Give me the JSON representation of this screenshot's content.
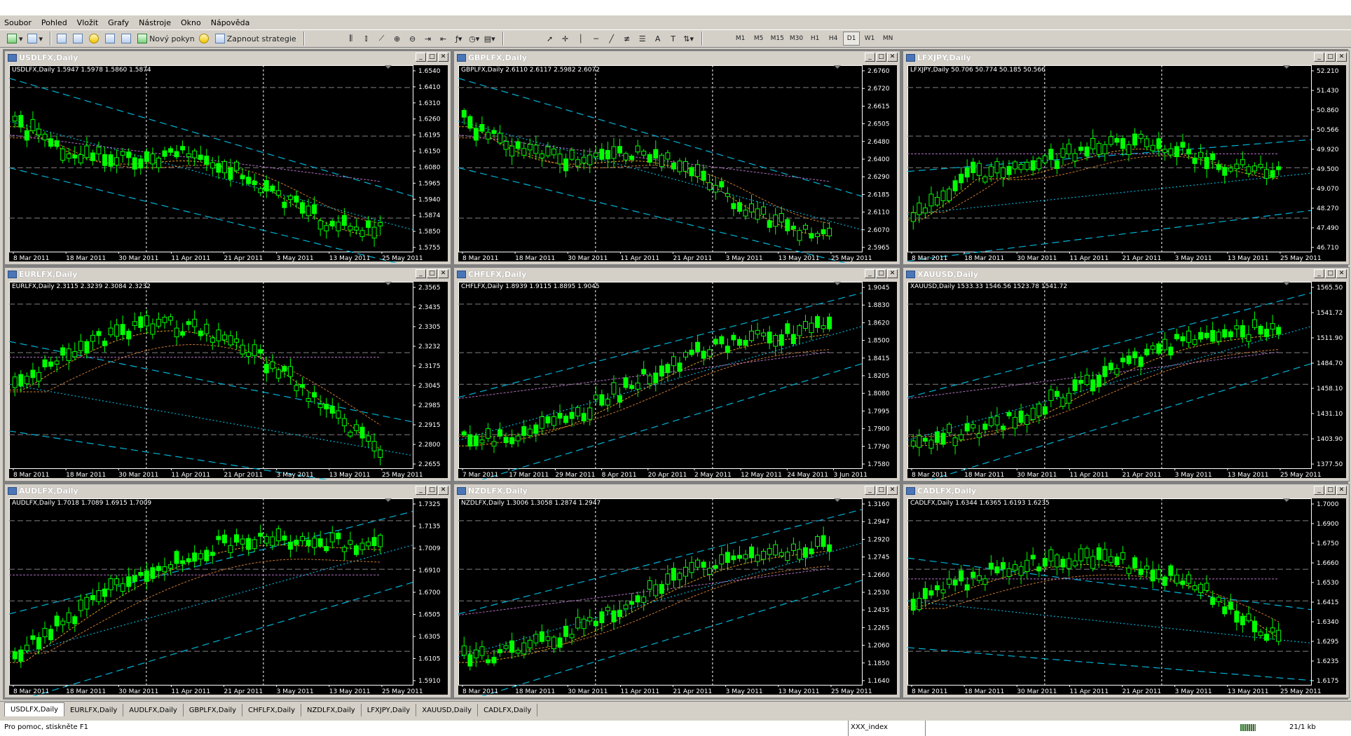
{
  "menu": [
    "Soubor",
    "Pohled",
    "Vložit",
    "Grafy",
    "Nástroje",
    "Okno",
    "Nápověda"
  ],
  "toolbar": {
    "new_order": "Nový pokyn",
    "strategies": "Zapnout strategie",
    "timeframes": [
      "M1",
      "M5",
      "M15",
      "M30",
      "H1",
      "H4",
      "D1",
      "W1",
      "MN"
    ],
    "active_tf": "D1"
  },
  "charts": [
    {
      "title": "USDLFX,Daily",
      "ohlc": "USDLFX,Daily  1.5947 1.5978 1.5860 1.5874",
      "prices": [
        "1.6540",
        "1.6410",
        "1.6310",
        "1.6260",
        "1.6195",
        "1.6150",
        "1.6080",
        "1.5965",
        "1.5940",
        "1.5874",
        "1.5850",
        "1.5755"
      ],
      "dates": [
        "8 Mar 2011",
        "18 Mar 2011",
        "30 Mar 2011",
        "11 Apr 2011",
        "21 Apr 2011",
        "3 May 2011",
        "13 May 2011",
        "25 May 2011"
      ],
      "trend": "down"
    },
    {
      "title": "GBPLFX,Daily",
      "ohlc": "GBPLFX,Daily  2.6110 2.6117 2.5982 2.6072",
      "prices": [
        "2.6760",
        "2.6720",
        "2.6615",
        "2.6505",
        "2.6480",
        "2.6400",
        "2.6290",
        "2.6185",
        "2.6110",
        "2.6070",
        "2.5965"
      ],
      "dates": [
        "8 Mar 2011",
        "18 Mar 2011",
        "30 Mar 2011",
        "11 Apr 2011",
        "21 Apr 2011",
        "3 May 2011",
        "13 May 2011",
        "25 May 2011"
      ],
      "trend": "down"
    },
    {
      "title": "LFXJPY,Daily",
      "ohlc": "LFXJPY,Daily  50.706 50.774 50.185 50.566",
      "prices": [
        "52.210",
        "51.430",
        "50.860",
        "50.566",
        "49.920",
        "49.500",
        "49.070",
        "48.270",
        "47.490",
        "46.710"
      ],
      "dates": [
        "8 Mar 2011",
        "18 Mar 2011",
        "30 Mar 2011",
        "11 Apr 2011",
        "21 Apr 2011",
        "3 May 2011",
        "13 May 2011",
        "25 May 2011"
      ],
      "trend": "flat"
    },
    {
      "title": "EURLFX,Daily",
      "ohlc": "EURLFX,Daily  2.3115 2.3239 2.3084 2.3232",
      "prices": [
        "2.3565",
        "2.3435",
        "2.3305",
        "2.3232",
        "2.3175",
        "2.3045",
        "2.2985",
        "2.2915",
        "2.2800",
        "2.2655"
      ],
      "dates": [
        "8 Mar 2011",
        "18 Mar 2011",
        "30 Mar 2011",
        "11 Apr 2011",
        "21 Apr 2011",
        "3 May 2011",
        "13 May 2011",
        "25 May 2011"
      ],
      "trend": "hump"
    },
    {
      "title": "CHFLFX,Daily",
      "ohlc": "CHFLFX,Daily  1.8939 1.9115 1.8895 1.9045",
      "prices": [
        "1.9045",
        "1.8830",
        "1.8620",
        "1.8500",
        "1.8415",
        "1.8205",
        "1.8080",
        "1.7995",
        "1.7900",
        "1.7790",
        "1.7580"
      ],
      "dates": [
        "7 Mar 2011",
        "17 Mar 2011",
        "29 Mar 2011",
        "8 Apr 2011",
        "20 Apr 2011",
        "2 May 2011",
        "12 May 2011",
        "24 May 2011",
        "3 Jun 2011"
      ],
      "trend": "up"
    },
    {
      "title": "XAUUSD,Daily",
      "ohlc": "XAUUSD,Daily  1533.33 1546.56 1523.78 1541.72",
      "prices": [
        "1565.50",
        "1541.72",
        "1511.90",
        "1484.70",
        "1458.10",
        "1431.10",
        "1403.90",
        "1377.50"
      ],
      "dates": [
        "8 Mar 2011",
        "18 Mar 2011",
        "30 Mar 2011",
        "11 Apr 2011",
        "21 Apr 2011",
        "3 May 2011",
        "13 May 2011",
        "25 May 2011"
      ],
      "trend": "up"
    },
    {
      "title": "AUDLFX,Daily",
      "ohlc": "AUDLFX,Daily  1.7018 1.7089 1.6915 1.7009",
      "prices": [
        "1.7325",
        "1.7135",
        "1.7009",
        "1.6910",
        "1.6700",
        "1.6505",
        "1.6305",
        "1.6105",
        "1.5910"
      ],
      "dates": [
        "8 Mar 2011",
        "18 Mar 2011",
        "30 Mar 2011",
        "11 Apr 2011",
        "21 Apr 2011",
        "3 May 2011",
        "13 May 2011",
        "25 May 2011"
      ],
      "trend": "uphump"
    },
    {
      "title": "NZDLFX,Daily",
      "ohlc": "NZDLFX,Daily  1.3006 1.3058 1.2874 1.2947",
      "prices": [
        "1.3160",
        "1.2947",
        "1.2920",
        "1.2745",
        "1.2660",
        "1.2530",
        "1.2435",
        "1.2265",
        "1.2060",
        "1.1850",
        "1.1640"
      ],
      "dates": [
        "8 Mar 2011",
        "18 Mar 2011",
        "30 Mar 2011",
        "11 Apr 2011",
        "21 Apr 2011",
        "3 May 2011",
        "13 May 2011",
        "25 May 2011"
      ],
      "trend": "up"
    },
    {
      "title": "CADLFX,Daily",
      "ohlc": "CADLFX,Daily  1.6344 1.6365 1.6193 1.6235",
      "prices": [
        "1.7000",
        "1.6900",
        "1.6750",
        "1.6660",
        "1.6530",
        "1.6415",
        "1.6340",
        "1.6295",
        "1.6235",
        "1.6175"
      ],
      "dates": [
        "8 Mar 2011",
        "18 Mar 2011",
        "30 Mar 2011",
        "11 Apr 2011",
        "21 Apr 2011",
        "3 May 2011",
        "13 May 2011",
        "25 May 2011"
      ],
      "trend": "humpdown"
    }
  ],
  "tabs": [
    "USDLFX,Daily",
    "EURLFX,Daily",
    "AUDLFX,Daily",
    "GBPLFX,Daily",
    "CHFLFX,Daily",
    "NZDLFX,Daily",
    "LFXJPY,Daily",
    "XAUUSD,Daily",
    "CADLFX,Daily"
  ],
  "status": {
    "help": "Pro pomoc, stiskněte F1",
    "profile": "XXX_index",
    "traffic": "21/1 kb"
  },
  "colors": {
    "bg": "#000000",
    "candle": "#00ff00",
    "axis": "#ffffff",
    "channel": "#00b4d8",
    "grid": "#808080"
  }
}
